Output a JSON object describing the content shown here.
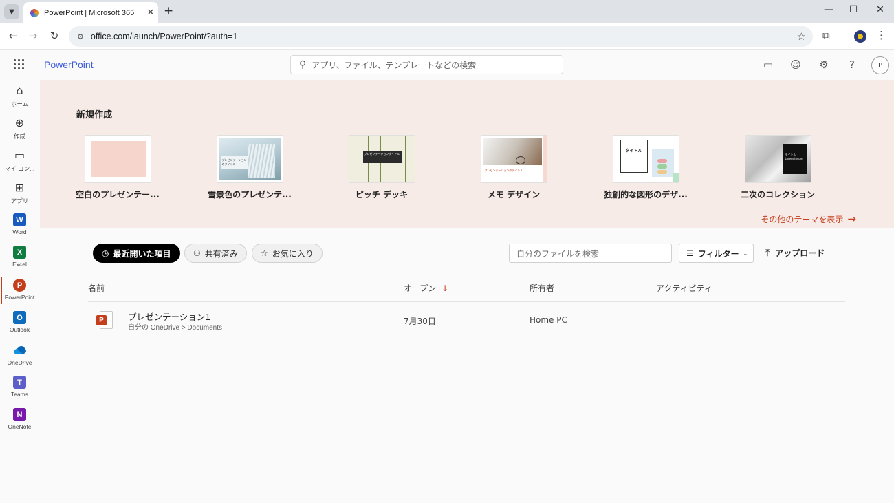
{
  "browser": {
    "tab_title": "PowerPoint | Microsoft 365",
    "url": "office.com/launch/PowerPoint/?auth=1"
  },
  "header": {
    "app_name": "PowerPoint",
    "search_placeholder": "アプリ、ファイル、テンプレートなどの検索",
    "avatar_initial": "P"
  },
  "rail": {
    "items": [
      {
        "label": "ホーム",
        "icon": "home-icon"
      },
      {
        "label": "作成",
        "icon": "create-icon"
      },
      {
        "label": "マイ コン...",
        "icon": "folder-icon"
      },
      {
        "label": "アプリ",
        "icon": "apps-icon"
      },
      {
        "label": "Word",
        "icon": "word-icon",
        "glyph": "W",
        "color": "#185abd"
      },
      {
        "label": "Excel",
        "icon": "excel-icon",
        "glyph": "X",
        "color": "#107c41"
      },
      {
        "label": "PowerPoint",
        "icon": "powerpoint-icon",
        "glyph": "P",
        "color": "#c43e1c"
      },
      {
        "label": "Outlook",
        "icon": "outlook-icon",
        "glyph": "O",
        "color": "#0f6cbd"
      },
      {
        "label": "OneDrive",
        "icon": "onedrive-icon"
      },
      {
        "label": "Teams",
        "icon": "teams-icon",
        "glyph": "T",
        "color": "#5b5fc7"
      },
      {
        "label": "OneNote",
        "icon": "onenote-icon",
        "glyph": "N",
        "color": "#7719aa"
      }
    ]
  },
  "new_section": {
    "title": "新規作成",
    "templates": [
      {
        "label": "空白のプレゼンテー..."
      },
      {
        "label": "雪景色のプレゼンテ...",
        "thumb_text": "プレゼンテーションのタイトル"
      },
      {
        "label": "ピッチ デッキ",
        "thumb_text": "プレゼンテーションタイトル"
      },
      {
        "label": "メモ デザイン",
        "thumb_text": "プレゼンテーションのタイトル"
      },
      {
        "label": "独創的な図形のデザ...",
        "thumb_text": "タイトル"
      },
      {
        "label": "二次のコレクション",
        "thumb_text": "タイトル Lorem Ipsum"
      }
    ],
    "more_link": "その他のテーマを表示"
  },
  "files": {
    "tabs": [
      {
        "label": "最近開いた項目"
      },
      {
        "label": "共有済み"
      },
      {
        "label": "お気に入り"
      }
    ],
    "search_placeholder": "自分のファイルを検索",
    "filter_label": "フィルター",
    "upload_label": "アップロード",
    "columns": {
      "name": "名前",
      "opened": "オープン",
      "owner": "所有者",
      "activity": "アクティビティ"
    },
    "rows": [
      {
        "name": "プレゼンテーション1",
        "path": "自分の OneDrive > Documents",
        "opened": "7月30日",
        "owner": "Home PC",
        "activity": ""
      }
    ]
  }
}
